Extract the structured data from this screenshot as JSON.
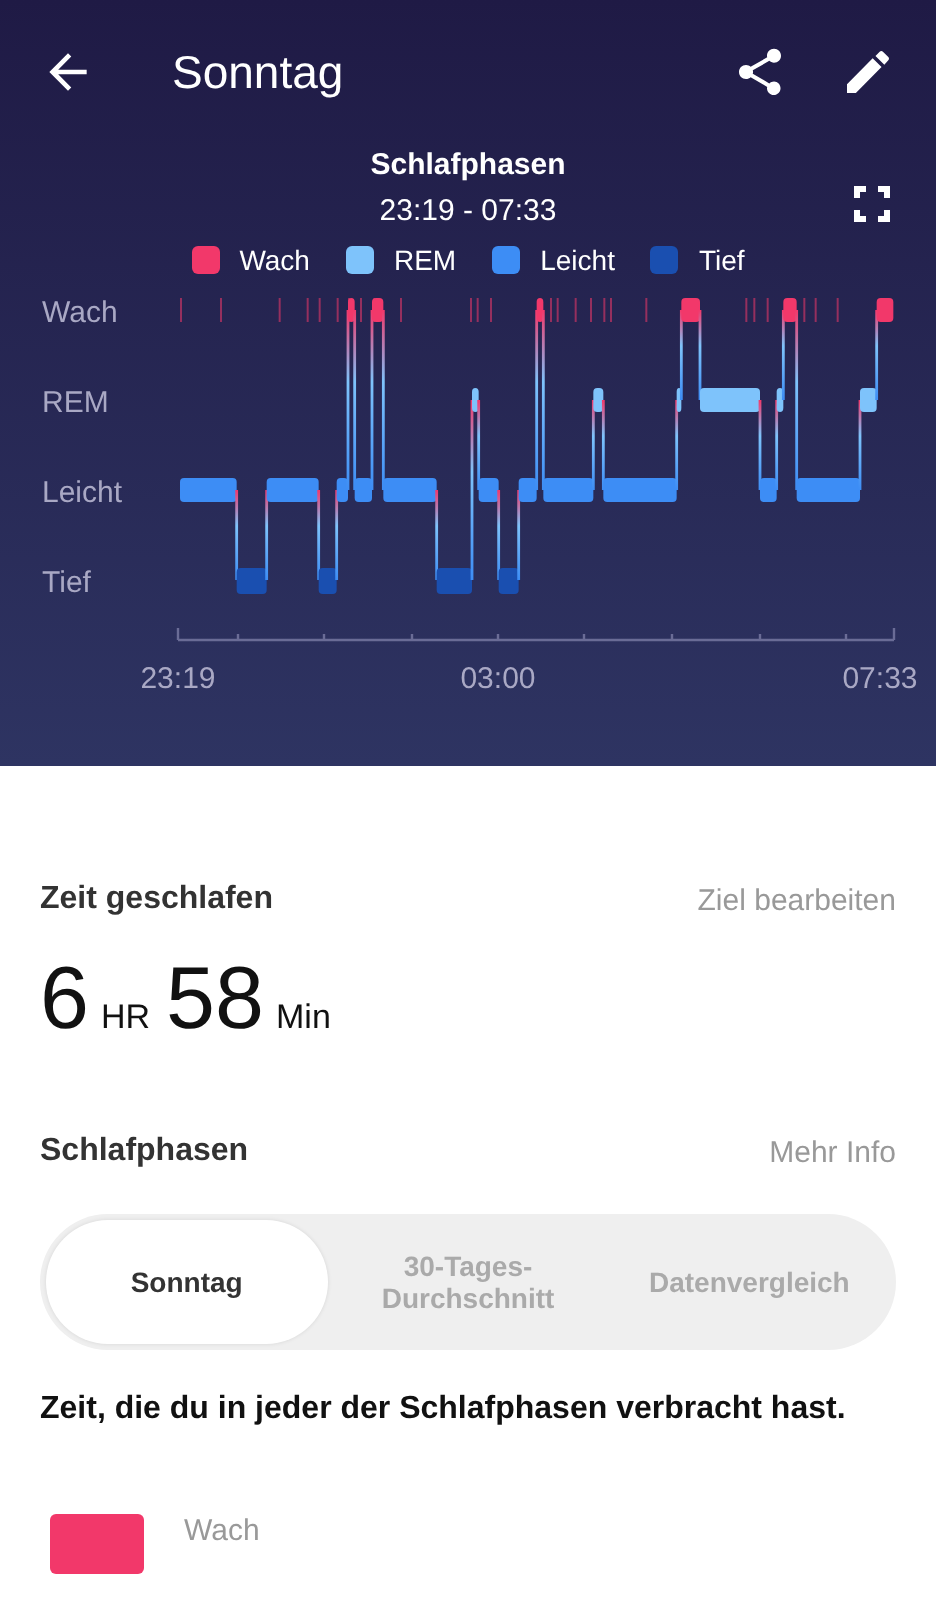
{
  "header": {
    "title": "Sonntag"
  },
  "chart": {
    "title": "Schlafphasen",
    "time_range": "23:19 - 07:33",
    "legend": [
      {
        "label": "Wach",
        "color": "#f2386a"
      },
      {
        "label": "REM",
        "color": "#7ec3fb"
      },
      {
        "label": "Leicht",
        "color": "#3d8df5"
      },
      {
        "label": "Tief",
        "color": "#1a4fb0"
      }
    ],
    "y_labels": [
      "Wach",
      "REM",
      "Leicht",
      "Tief"
    ],
    "x_labels": [
      "23:19",
      "03:00",
      "07:33"
    ]
  },
  "sleep": {
    "title": "Zeit geschlafen",
    "action": "Ziel bearbeiten",
    "hours": "6",
    "hours_unit": "HR",
    "minutes": "58",
    "minutes_unit": "Min"
  },
  "stages": {
    "title": "Schlafphasen",
    "action": "Mehr Info",
    "tabs": [
      {
        "label": "Sonntag",
        "selected": true
      },
      {
        "label": "30-Tages-Durchschnitt",
        "selected": false
      },
      {
        "label": "Datenvergleich",
        "selected": false
      }
    ],
    "description": "Zeit, die du in jeder der Schlafphasen verbracht hast.",
    "rows": [
      {
        "label": "Wach",
        "color": "#f2386a"
      }
    ]
  }
}
